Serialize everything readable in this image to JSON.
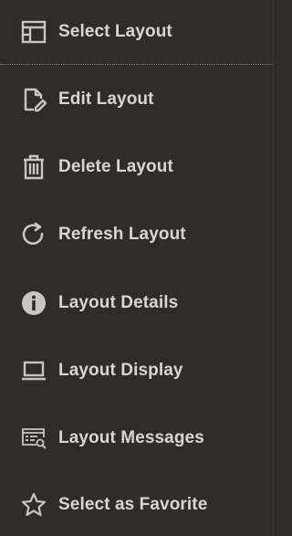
{
  "menu": {
    "items": [
      {
        "label": "Select Layout",
        "icon": "select-layout-icon"
      },
      {
        "label": "Edit Layout",
        "icon": "edit-layout-icon"
      },
      {
        "label": "Delete Layout",
        "icon": "trash-icon"
      },
      {
        "label": "Refresh Layout",
        "icon": "refresh-icon"
      },
      {
        "label": "Layout Details",
        "icon": "info-icon"
      },
      {
        "label": "Layout Display",
        "icon": "laptop-icon"
      },
      {
        "label": "Layout Messages",
        "icon": "messages-search-icon"
      },
      {
        "label": "Select as Favorite",
        "icon": "star-icon"
      }
    ]
  },
  "colors": {
    "background": "#2f2c29",
    "text": "#d9d6d2",
    "icon": "#c9c5c0",
    "divider": "#8a8681"
  }
}
